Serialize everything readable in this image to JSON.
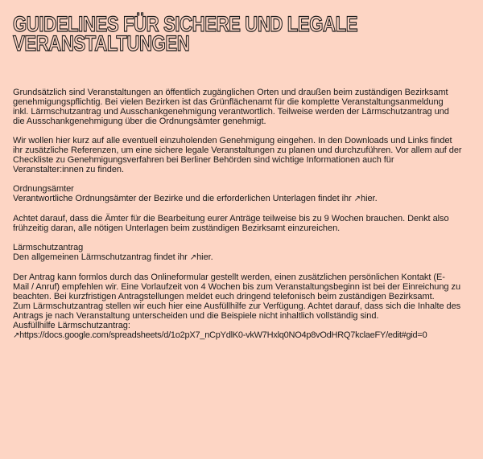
{
  "title": {
    "line1": "Guidelines für sichere und legale",
    "line2": "Veranstaltungen"
  },
  "intro": {
    "line1": "Grundsätzlich sind Veranstaltungen an öffentlich zugänglichen Orten und draußen beim zuständigen Bezirksamt",
    "line2": "genehmigungspflichtig. Bei vielen Bezirken ist das Grünflächenamt für die komplette Veranstaltungsanmeldung",
    "line3": "inkl. Lärmschutzantrag und Ausschankgenehmigung verantwortlich. Teilweise werden der Lärmschutzantrag und",
    "line4": "die Ausschankgenehmigung über die Ordnungsämter genehmigt."
  },
  "downloads": {
    "line1": "Wir wollen hier kurz auf alle eventuell einzuholenden Genehmigung eingehen. In den Downloads und Links findet",
    "line2": "ihr zusätzliche Referenzen, um eine sichere legale Veranstaltungen zu planen und durchzuführen. Vor allem auf der",
    "line3": "Checkliste zu Genehmigungsverfahren bei Berliner Behörden sind wichtige Informationen auch für",
    "line4": "Veranstalter:innen zu finden."
  },
  "ordnungsaemter": {
    "heading": "Ordnungsämter",
    "text": "Verantwortliche Ordnungsämter der Bezirke und die erforderlichen Unterlagen findet ihr ",
    "link": "hier",
    "end": "."
  },
  "notice": {
    "line1": "Achtet darauf, dass die Ämter für die Bearbeitung eurer Anträge teilweise bis zu 9 Wochen brauchen. Denkt also",
    "line2": "frühzeitig daran, alle nötigen Unterlagen beim zuständigen Bezirksamt einzureichen."
  },
  "laermschutz": {
    "heading": "Lärmschutzantrag",
    "text": "Den allgemeinen Lärmschutzantrag findet ihr ",
    "link": "hier",
    "end": "."
  },
  "antrag": {
    "line1": "Der Antrag kann formlos durch das Onlineformular gestellt werden, einen zusätzlichen persönlichen Kontakt (E-",
    "line2": "Mail / Anruf) empfehlen wir. Eine Vorlaufzeit von 4 Wochen bis zum Veranstaltungsbeginn ist bei der Einreichung zu",
    "line3": "beachten. Bei kurzfristigen Antragstellungen meldet euch dringend telefonisch beim zuständigen Bezirksamt.",
    "line4": "Zum Lärmschutzantrag stellen wir euch hier eine Ausfüllhilfe zur Verfügung. Achtet darauf, dass sich die Inhalte des",
    "line5": "Antrags je nach Veranstaltung unterscheiden und die Beispiele nicht inhaltlich vollständig sind.",
    "line6": "Ausfüllhilfe Lärmschutzantrag:",
    "url": "https://docs.google.com/spreadsheets/d/1o2pX7_nCpYdlK0-vkW7Hxlq0NO4p8vOdHRQ7kclaeFY/edit#gid=0"
  },
  "icons": {
    "external_link": "arrow-up-right-icon",
    "glyph": "↗"
  }
}
